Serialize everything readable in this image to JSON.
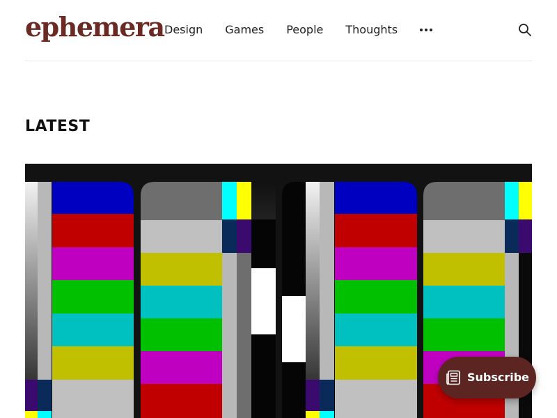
{
  "site": {
    "name": "ephemera",
    "brand_color": "#6b2a24"
  },
  "nav": {
    "items": [
      "Design",
      "Games",
      "People",
      "Thoughts"
    ],
    "more_icon": "ellipsis-icon"
  },
  "search": {
    "icon": "search-icon"
  },
  "latest": {
    "title": "LATEST"
  },
  "hero": {
    "icon": "tv-color-bars-image",
    "bar_colors": [
      "#0000c0",
      "#c00000",
      "#c000c0",
      "#00c000",
      "#00c0c0",
      "#c0c000",
      "#c0c0c0"
    ]
  },
  "subscribe": {
    "label": "Subscribe",
    "icon": "newsletter-icon",
    "color": "#5c2521"
  }
}
